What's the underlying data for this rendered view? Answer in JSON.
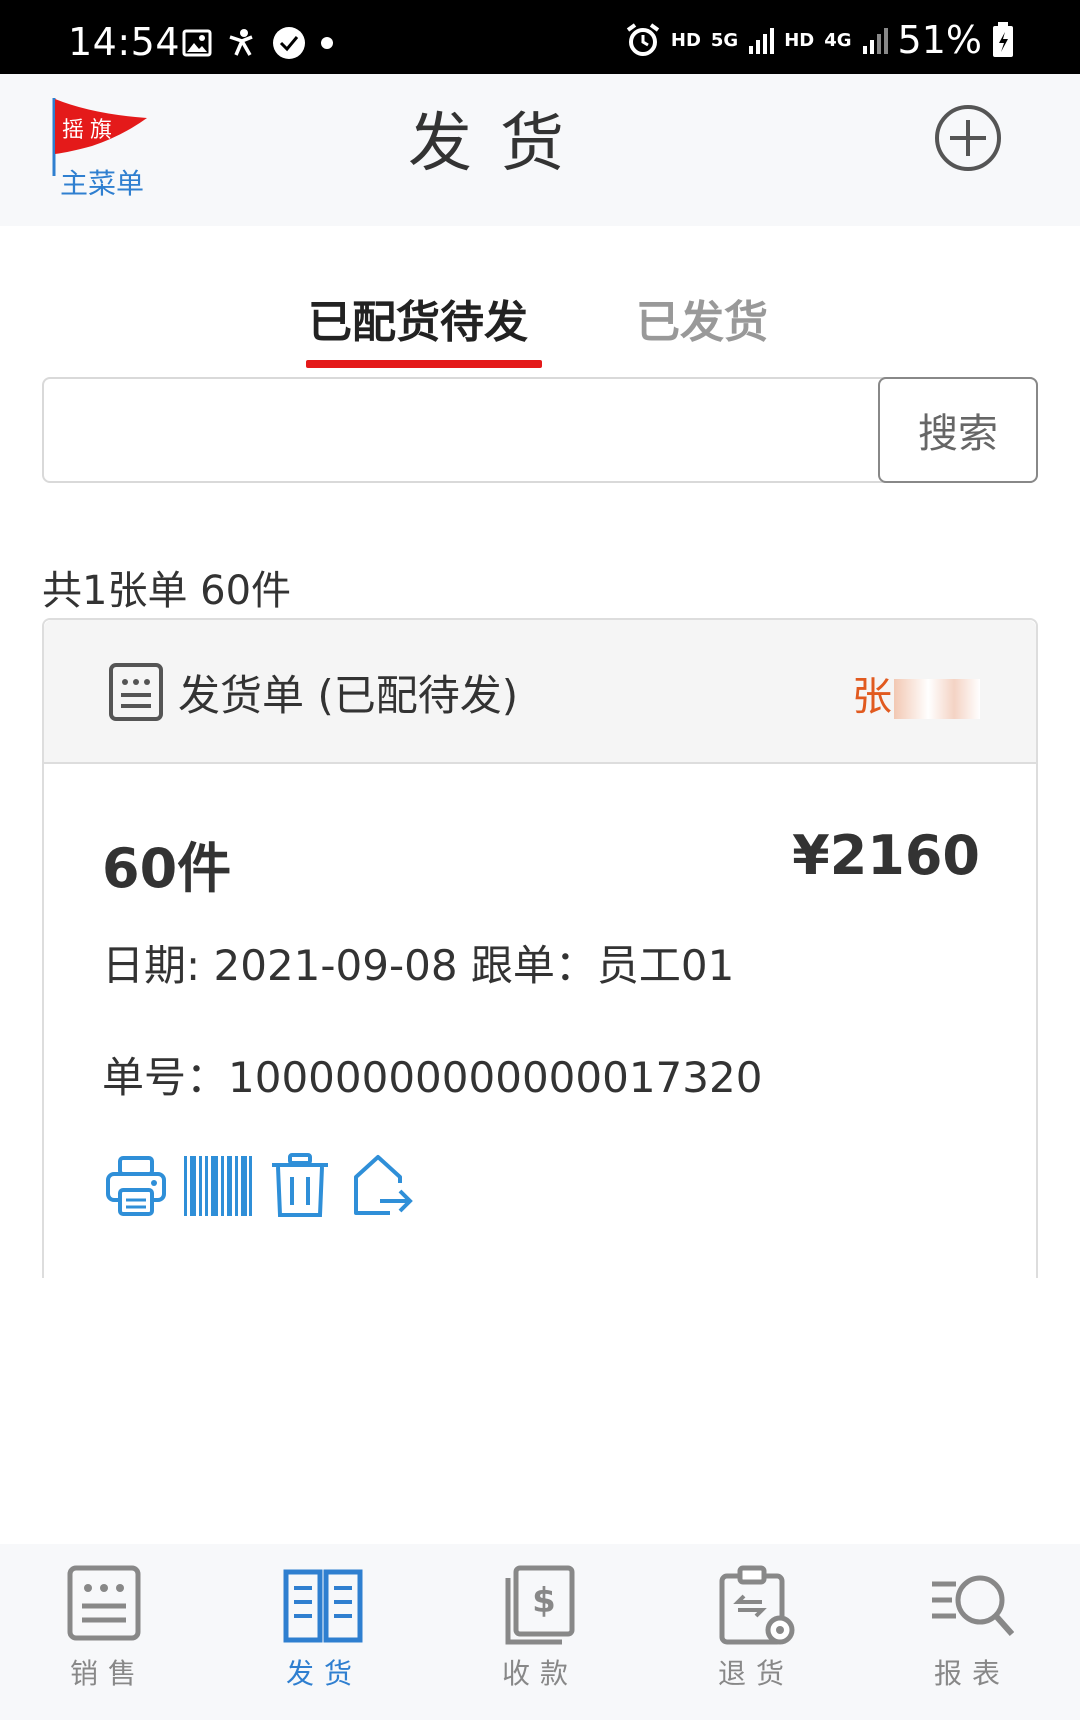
{
  "status_bar": {
    "time": "14:54",
    "left_icons": [
      "image-icon",
      "person-icon",
      "check-badge-icon",
      "dot-icon"
    ],
    "net1": "HD",
    "net2": "5G",
    "net3": "HD",
    "net4": "4G",
    "battery": "51%"
  },
  "header": {
    "logo_flag_text": "摇旗",
    "logo_menu": "主菜单",
    "title": "发货",
    "add_icon": "plus-circle-icon"
  },
  "tabs": [
    {
      "label": "已配货待发",
      "active": true
    },
    {
      "label": "已发货",
      "active": false
    }
  ],
  "search": {
    "value": "",
    "placeholder": "",
    "button_label": "搜索"
  },
  "summary": "共1张单 60件",
  "order_card": {
    "title": "发货单 (已配待发)",
    "user_visible": "张",
    "qty": "60件",
    "amount": "¥2160",
    "date_line": "日期: 2021-09-08 跟单：员工01",
    "order_line": "单号：10000000000000017320",
    "actions": [
      "print-icon",
      "barcode-icon",
      "trash-icon",
      "export-icon"
    ]
  },
  "bottom_nav": [
    {
      "label": "销售",
      "icon": "sales-icon",
      "active": false
    },
    {
      "label": "发货",
      "icon": "shipping-icon",
      "active": true
    },
    {
      "label": "收款",
      "icon": "payment-icon",
      "active": false
    },
    {
      "label": "退货",
      "icon": "return-icon",
      "active": false
    },
    {
      "label": "报表",
      "icon": "report-icon",
      "active": false
    }
  ],
  "colors": {
    "accent_blue": "#2f7fd0",
    "tab_red": "#e41a1a",
    "user_orange": "#e15a1f",
    "inactive_gray": "#888888"
  }
}
